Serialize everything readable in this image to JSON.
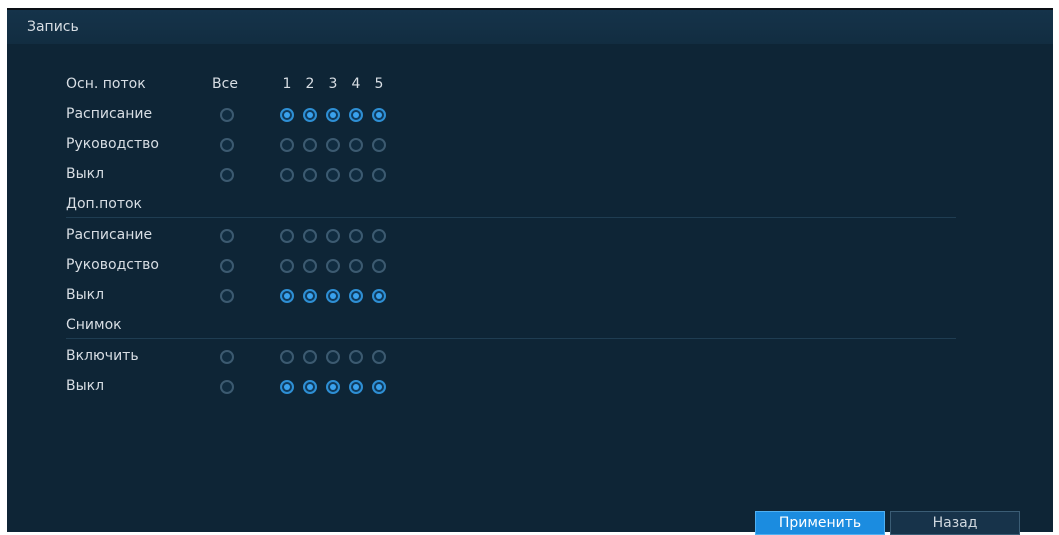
{
  "window": {
    "title": "Запись"
  },
  "columns": {
    "header": "Осн. поток",
    "all": "Все",
    "channels": [
      "1",
      "2",
      "3",
      "4",
      "5"
    ]
  },
  "main_stream": {
    "schedule_label": "Расписание",
    "manual_label": "Руководство",
    "off_label": "Выкл",
    "selected": "schedule"
  },
  "sub_stream": {
    "section_label": "Доп.поток",
    "schedule_label": "Расписание",
    "manual_label": "Руководство",
    "off_label": "Выкл",
    "selected": "off"
  },
  "snapshot": {
    "section_label": "Снимок",
    "enable_label": "Включить",
    "off_label": "Выкл",
    "selected": "off"
  },
  "buttons": {
    "apply": "Применить",
    "back": "Назад"
  },
  "colors": {
    "accent": "#1b8ce0",
    "panel": "#0e2536"
  }
}
